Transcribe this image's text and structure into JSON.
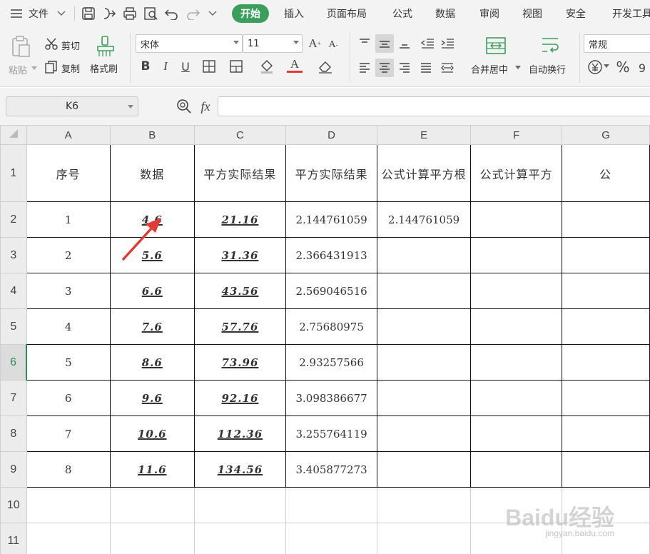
{
  "menu": {
    "file": "文件",
    "tabs": [
      "开始",
      "插入",
      "页面布局",
      "公式",
      "数据",
      "审阅",
      "视图",
      "安全",
      "开发工具"
    ]
  },
  "ribbon": {
    "paste": "粘贴",
    "cut": "剪切",
    "copy": "复制",
    "format_painter": "格式刷",
    "font_name": "宋体",
    "font_size": "11",
    "merge_center": "合并居中",
    "wrap_text": "自动换行",
    "number_format": "常规"
  },
  "formula_bar": {
    "cell_ref": "K6",
    "fx": "fx",
    "content": ""
  },
  "sheet": {
    "columns": [
      "A",
      "B",
      "C",
      "D",
      "E",
      "F",
      "G"
    ],
    "row_numbers": [
      "1",
      "2",
      "3",
      "4",
      "5",
      "6",
      "7",
      "8",
      "9",
      "10",
      "11"
    ],
    "active_row": "6",
    "headers": [
      "序号",
      "数据",
      "平方实际结果",
      "平方实际结果",
      "公式计算平方根",
      "公式计算平方",
      "公"
    ],
    "rows": [
      [
        "1",
        "4.6",
        "21.16",
        "2.144761059",
        "2.144761059",
        "",
        ""
      ],
      [
        "2",
        "5.6",
        "31.36",
        "2.366431913",
        "",
        "",
        ""
      ],
      [
        "3",
        "6.6",
        "43.56",
        "2.569046516",
        "",
        "",
        ""
      ],
      [
        "4",
        "7.6",
        "57.76",
        "2.75680975",
        "",
        "",
        ""
      ],
      [
        "5",
        "8.6",
        "73.96",
        "2.93257566",
        "",
        "",
        ""
      ],
      [
        "6",
        "9.6",
        "92.16",
        "3.098386677",
        "",
        "",
        ""
      ],
      [
        "7",
        "10.6",
        "112.36",
        "3.255764119",
        "",
        "",
        ""
      ],
      [
        "8",
        "11.6",
        "134.56",
        "3.405877273",
        "",
        "",
        ""
      ]
    ]
  },
  "watermark": {
    "logo": "Baidu经验",
    "url": "jingyan.baidu.com"
  },
  "colors": {
    "accent": "#3b9f5c",
    "arrow": "#e53935"
  }
}
